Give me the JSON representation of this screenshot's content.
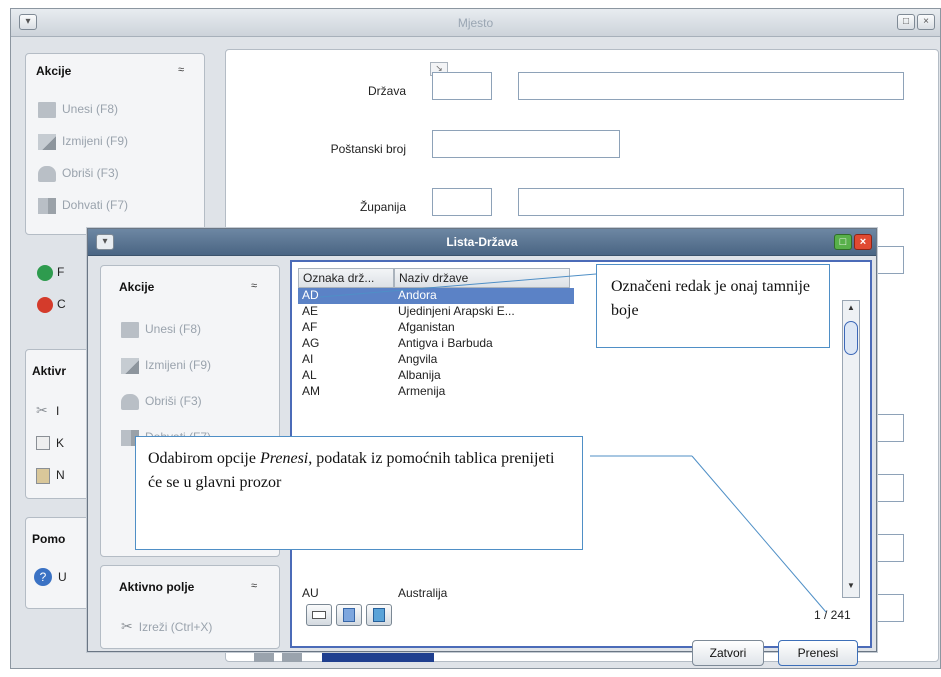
{
  "main": {
    "title": "Mjesto",
    "sidebar": {
      "akcije_title": "Akcije",
      "actions": [
        "Unesi (F8)",
        "Izmijeni (F9)",
        "Obriši (F3)",
        "Dohvati (F7)"
      ],
      "extra_letters": [
        "F",
        "C"
      ],
      "aktivno_title": "Aktivr",
      "aktivno_letters": [
        "I",
        "K",
        "N"
      ],
      "pomoc_title": "Pomo",
      "pomoc_letter": "U"
    },
    "form": {
      "labels": [
        "Država",
        "Poštanski broj",
        "Županija"
      ]
    }
  },
  "modal": {
    "title": "Lista-Država",
    "sidebar": {
      "akcije_title": "Akcije",
      "actions": [
        "Unesi (F8)",
        "Izmijeni (F9)",
        "Obriši (F3)",
        "Dohvati (F7)"
      ],
      "aktivno_title": "Aktivno polje",
      "cut_label": "Izreži (Ctrl+X)"
    },
    "table": {
      "columns": [
        "Oznaka drž...",
        "Naziv države"
      ],
      "rows": [
        [
          "AD",
          "Andora"
        ],
        [
          "AE",
          "Ujedinjeni Arapski E..."
        ],
        [
          "AF",
          "Afganistan"
        ],
        [
          "AG",
          "Antigva i Barbuda"
        ],
        [
          "AI",
          "Angvila"
        ],
        [
          "AL",
          "Albanija"
        ],
        [
          "AM",
          "Armenija"
        ],
        [
          "AU",
          "Australija"
        ]
      ],
      "selected_index": 0
    },
    "counter": "1 / 241",
    "close_label": "Zatvori",
    "transfer_label": "Prenesi"
  },
  "callouts": {
    "selected_row": "Označeni redak je onaj tamnije boje",
    "transfer_pre": "Odabirom opcije ",
    "transfer_em": "Prenesi",
    "transfer_post": ", podatak iz pomoćnih tablica prenijeti će se u glavni prozor"
  },
  "colors": {
    "selection": "#5b82c6",
    "callout_border": "#4f8fc6",
    "list_border": "#4b6bb8"
  }
}
